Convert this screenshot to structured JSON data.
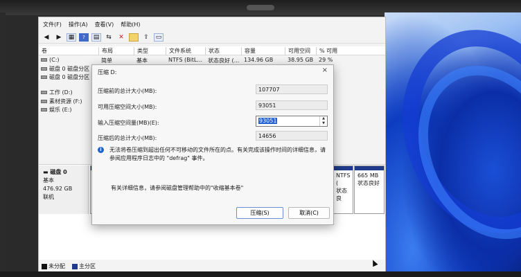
{
  "menubar": {
    "file": "文件(F)",
    "action": "操作(A)",
    "view": "查看(V)",
    "help": "帮助(H)"
  },
  "toolbar": {
    "icons": [
      "back-arrow-icon",
      "forward-arrow-icon",
      "grid-icon",
      "help-icon",
      "properties-icon",
      "connect-icon",
      "delete-icon",
      "folder-icon",
      "export-icon",
      "view-icon"
    ]
  },
  "table": {
    "columns": [
      "卷",
      "布局",
      "类型",
      "文件系统",
      "状态",
      "容量",
      "可用空间",
      "% 可用"
    ],
    "rows": [
      {
        "vol": "(C:)",
        "layout": "简单",
        "type": "基本",
        "fs": "NTFS (BitL...",
        "status": "状态良好 (...",
        "capacity": "134.96 GB",
        "free": "38.95 GB",
        "pct": "29 %"
      },
      {
        "vol": "磁盘 0 磁盘分区 1"
      },
      {
        "vol": "磁盘 0 磁盘分区 4"
      },
      {
        "vol": "工作 (D:)"
      },
      {
        "vol": "素材资源 (F:)"
      },
      {
        "vol": "娱乐 (E:)"
      }
    ]
  },
  "disk": {
    "title": "磁盘 0",
    "type": "基本",
    "size": "476.92 GB",
    "status": "联机",
    "part_ntfs": "NTFS (",
    "part_ok": "状态良",
    "part_size": "665 MB",
    "part_status": "状态良好"
  },
  "legend": {
    "unallocated": "未分配",
    "primary": "主分区"
  },
  "dialog": {
    "title": "压缩 D:",
    "total_before_label": "压缩前的总计大小(MB):",
    "total_before": "107707",
    "available_label": "可用压缩空间大小(MB):",
    "available": "93051",
    "amount_label": "输入压缩空间量(MB)(E):",
    "amount": "93051",
    "total_after_label": "压缩后的总计大小(MB):",
    "total_after": "14656",
    "info_line1": "无法将卷压缩到超出任何不可移动的文件所在的点。有关完成该操作时间的详细信息，请",
    "info_line2": "参阅应用程序日志中的 \"defrag\" 事件。",
    "detail": "有关详细信息，请参阅磁盘管理帮助中的\"收缩基本卷\"",
    "shrink_btn": "压缩(S)",
    "cancel_btn": "取消(C)"
  },
  "colors": {
    "primary_partition": "#1f3a8a",
    "unallocated": "#111111",
    "accent": "#1f5fd1"
  }
}
